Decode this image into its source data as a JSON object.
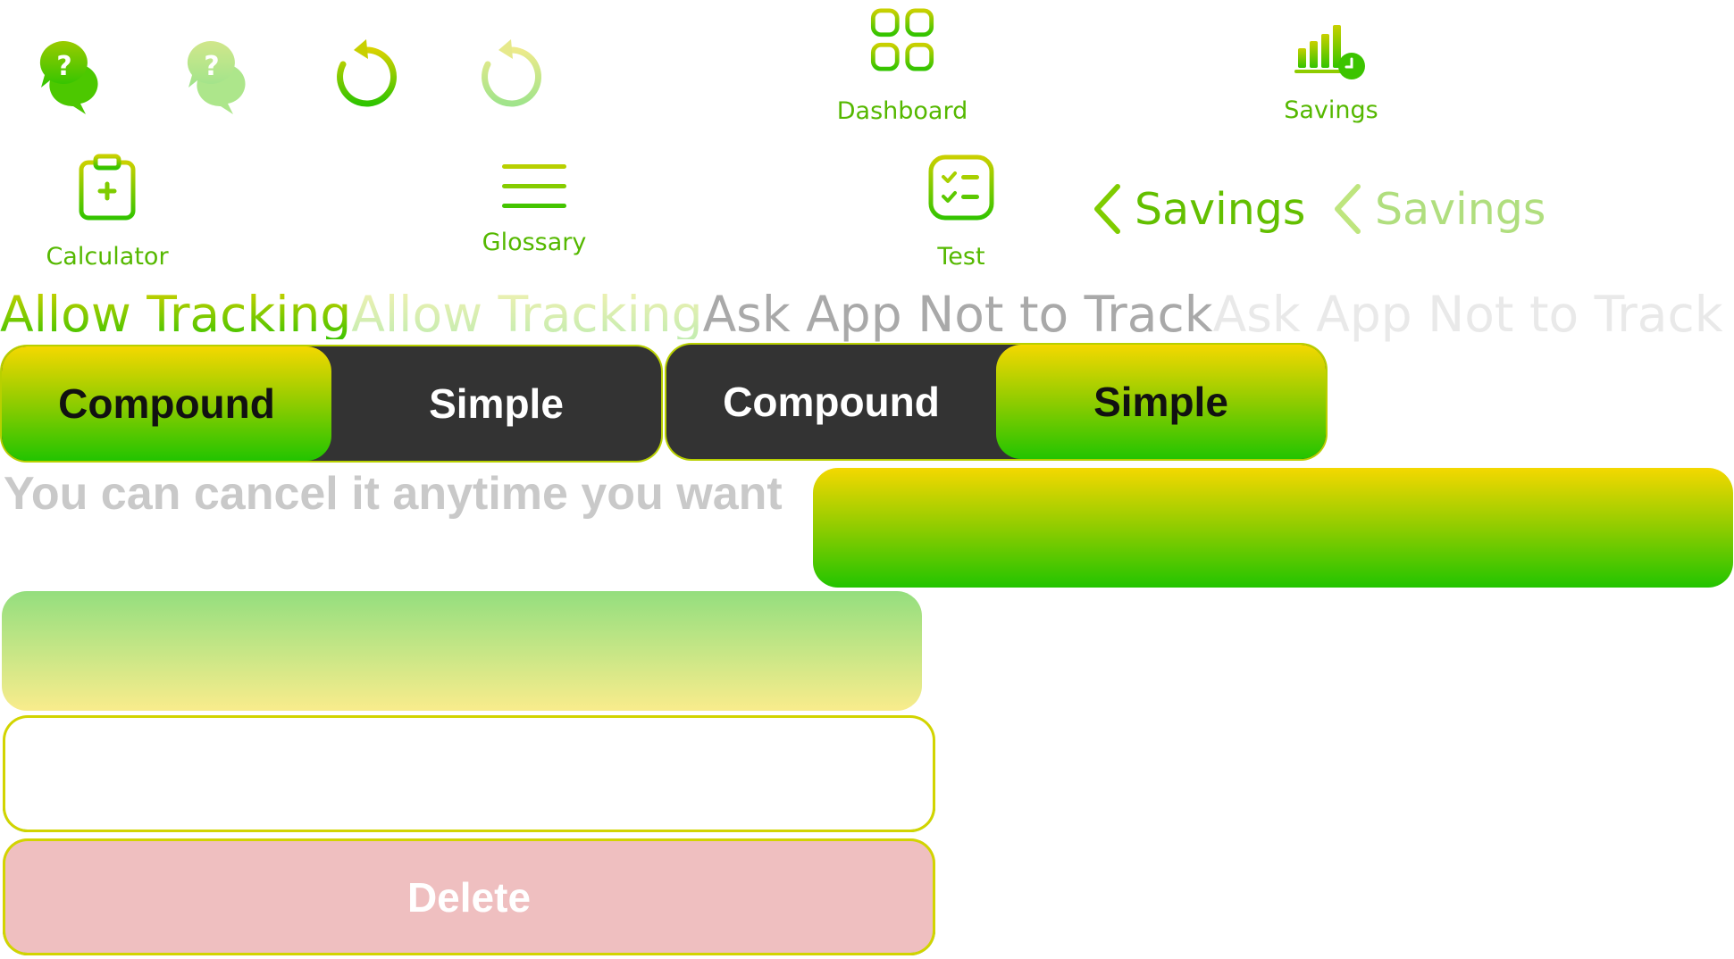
{
  "top_icons": {
    "help_active": "help-bubbles-icon",
    "help_disabled": "help-bubbles-icon",
    "reset_active": "reset-icon",
    "reset_disabled": "reset-icon"
  },
  "nav": {
    "dashboard": {
      "label": "Dashboard",
      "icon": "grid-icon"
    },
    "savings": {
      "label": "Savings",
      "icon": "bar-chart-clock-icon"
    },
    "calculator": {
      "label": "Calculator",
      "icon": "clipboard-plus-icon"
    },
    "glossary": {
      "label": "Glossary",
      "icon": "hamburger-icon"
    },
    "test": {
      "label": "Test",
      "icon": "checklist-icon"
    }
  },
  "back_links": [
    {
      "label": "Savings",
      "state": "active"
    },
    {
      "label": "Savings",
      "state": "disabled"
    }
  ],
  "tracking": {
    "allow_active": "Allow Tracking",
    "allow_disabled": "Allow Tracking",
    "ask_active": "Ask App Not to Track",
    "ask_disabled": "Ask App Not to Track"
  },
  "segmented_controls": [
    {
      "options": [
        "Compound",
        "Simple"
      ],
      "selected": "Compound"
    },
    {
      "options": [
        "Compound",
        "Simple"
      ],
      "selected": "Simple"
    }
  ],
  "cancel_note": "You can cancel it anytime you want",
  "buttons": {
    "delete_label": "Delete"
  },
  "colors": {
    "accent_green": "#55b800",
    "gradient_yellow": "#f4d800",
    "gradient_green": "#22c400",
    "segment_dark": "#333333",
    "delete_bg": "#efbfc0",
    "muted_text": "#c9c9c9"
  }
}
